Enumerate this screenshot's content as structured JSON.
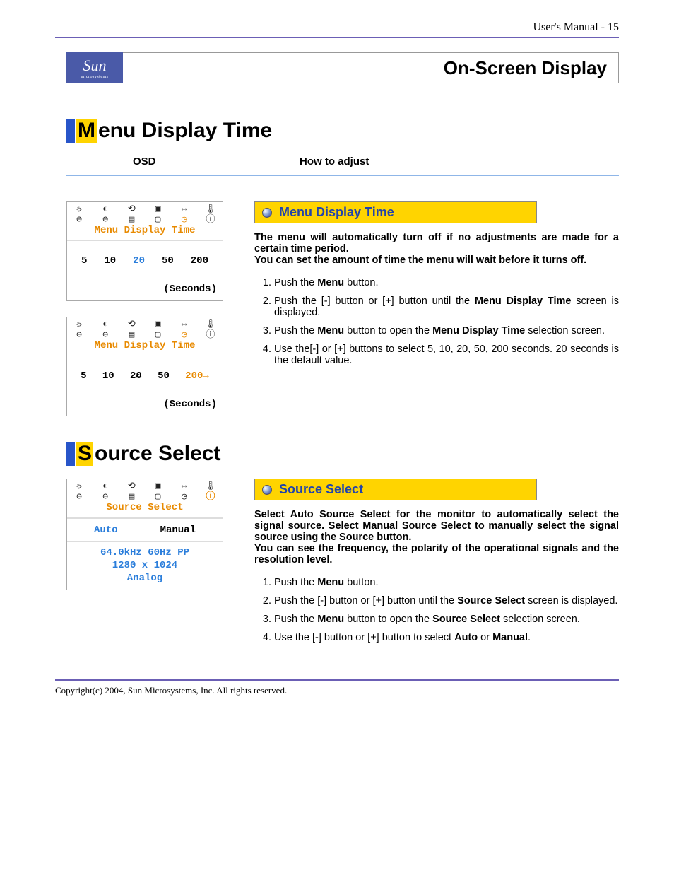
{
  "header": {
    "right": "User's Manual - 15"
  },
  "brand": {
    "name": "Sun",
    "sub": "microsystems"
  },
  "page_title": "On-Screen Display",
  "column_headers": {
    "left": "OSD",
    "right": "How to adjust"
  },
  "section1": {
    "heading_initial": "M",
    "heading_rest": "enu Display Time",
    "osd_a": {
      "label": "Menu Display Time",
      "values": [
        "5",
        "10",
        "20",
        "50",
        "200"
      ],
      "selected_index": 2,
      "selected_color": "blue",
      "unit": "(Seconds)"
    },
    "osd_b": {
      "label": "Menu Display Time",
      "values": [
        "5",
        "10",
        "20",
        "50",
        "200"
      ],
      "prefix_arrow_left": true,
      "suffix_arrow_right": true,
      "selected_index": 4,
      "selected_color": "orange",
      "unit": "(Seconds)"
    },
    "callout": "Menu Display Time",
    "desc_bold1": "The menu will automatically turn off if no adjustments are made for a certain time period.",
    "desc_bold2": "You can set the amount of time the menu will wait before it turns off.",
    "steps": [
      {
        "pre": "Push the ",
        "b1": "Menu",
        "post": " button."
      },
      {
        "pre": "Push the [-] button or [+] button until the ",
        "b1": "Menu Display Time",
        "post": " screen is displayed."
      },
      {
        "pre": "Push the ",
        "b1": "Menu",
        "mid": " button to open the ",
        "b2": "Menu Display Time",
        "post": " selection screen."
      },
      {
        "text": "Use the[-] or [+] buttons to select 5, 10, 20, 50, 200 seconds. 20 seconds is the default value."
      }
    ]
  },
  "section2": {
    "heading_initial": "S",
    "heading_rest": "ource Select",
    "osd": {
      "label": "Source Select",
      "options": [
        "Auto",
        "Manual"
      ],
      "selected_index": 0,
      "info_lines": [
        "64.0kHz 60Hz PP",
        "1280 x 1024",
        "Analog"
      ]
    },
    "callout": "Source Select",
    "desc_bold1": "Select Auto Source Select for the monitor to automatically select the signal source. Select Manual Source Select to manually select the signal source using the Source button.",
    "desc_bold2": "You can see the frequency, the polarity of the operational signals and the resolution level.",
    "steps": [
      {
        "pre": "Push the ",
        "b1": "Menu",
        "post": " button."
      },
      {
        "pre": "Push the [-] button or [+] button until the ",
        "b1": "Source Select",
        "post": " screen is displayed."
      },
      {
        "pre": "Push the ",
        "b1": "Menu",
        "mid": " button to open the ",
        "b2": "Source Select",
        "post": " selection screen."
      },
      {
        "pre": "Use the [-] button or [+] button to select ",
        "b1": "Auto",
        "mid": " or ",
        "b2": "Manual",
        "post": "."
      }
    ]
  },
  "footer": "Copyright(c) 2004, Sun Microsystems, Inc. All rights reserved."
}
